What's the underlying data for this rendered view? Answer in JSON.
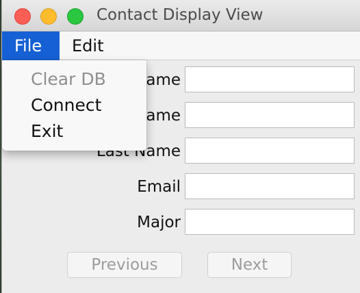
{
  "window": {
    "title": "Contact Display View"
  },
  "menubar": {
    "items": [
      {
        "label": "File",
        "active": true
      },
      {
        "label": "Edit",
        "active": false
      }
    ]
  },
  "file_menu": {
    "items": [
      {
        "label": "Clear DB",
        "enabled": false
      },
      {
        "label": "Connect",
        "enabled": true
      },
      {
        "label": "Exit",
        "enabled": true
      }
    ]
  },
  "form": {
    "fields": [
      {
        "label": "ame",
        "value": ""
      },
      {
        "label": "ame",
        "value": ""
      },
      {
        "label": "Last Name",
        "value": ""
      },
      {
        "label": "Email",
        "value": ""
      },
      {
        "label": "Major",
        "value": ""
      }
    ]
  },
  "buttons": {
    "previous": "Previous",
    "next": "Next"
  },
  "colors": {
    "menu_highlight": "#1560d4",
    "close": "#fd5f57",
    "minimize": "#febc2e",
    "zoom": "#29c840"
  }
}
